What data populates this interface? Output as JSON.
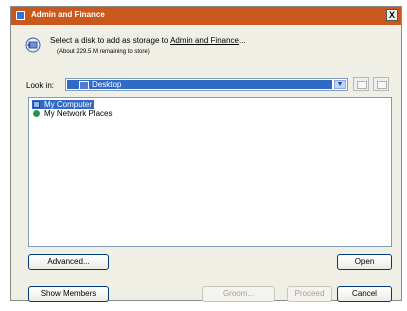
{
  "window": {
    "title": "Admin and Finance",
    "close_label": "X"
  },
  "header": {
    "prompt_prefix": "Select a disk to add as storage to ",
    "prompt_link": "Admin and Finance",
    "prompt_suffix": "...",
    "remaining": "(About 229.5 M remaining to store)"
  },
  "look_in": {
    "label": "Look in:",
    "value": "Desktop"
  },
  "list": {
    "items": [
      {
        "label": "My Computer",
        "icon": "my-computer-icon",
        "selected": true
      },
      {
        "label": "My Network Places",
        "icon": "network-places-icon",
        "selected": false
      }
    ]
  },
  "buttons": {
    "advanced": "Advanced...",
    "open": "Open",
    "show_members": "Show Members",
    "groom": "Groom...",
    "proceed": "Proceed",
    "cancel": "Cancel"
  },
  "colors": {
    "titlebar": "#c8581c",
    "selection": "#316ac5",
    "dialog_bg": "#f0efe6"
  }
}
